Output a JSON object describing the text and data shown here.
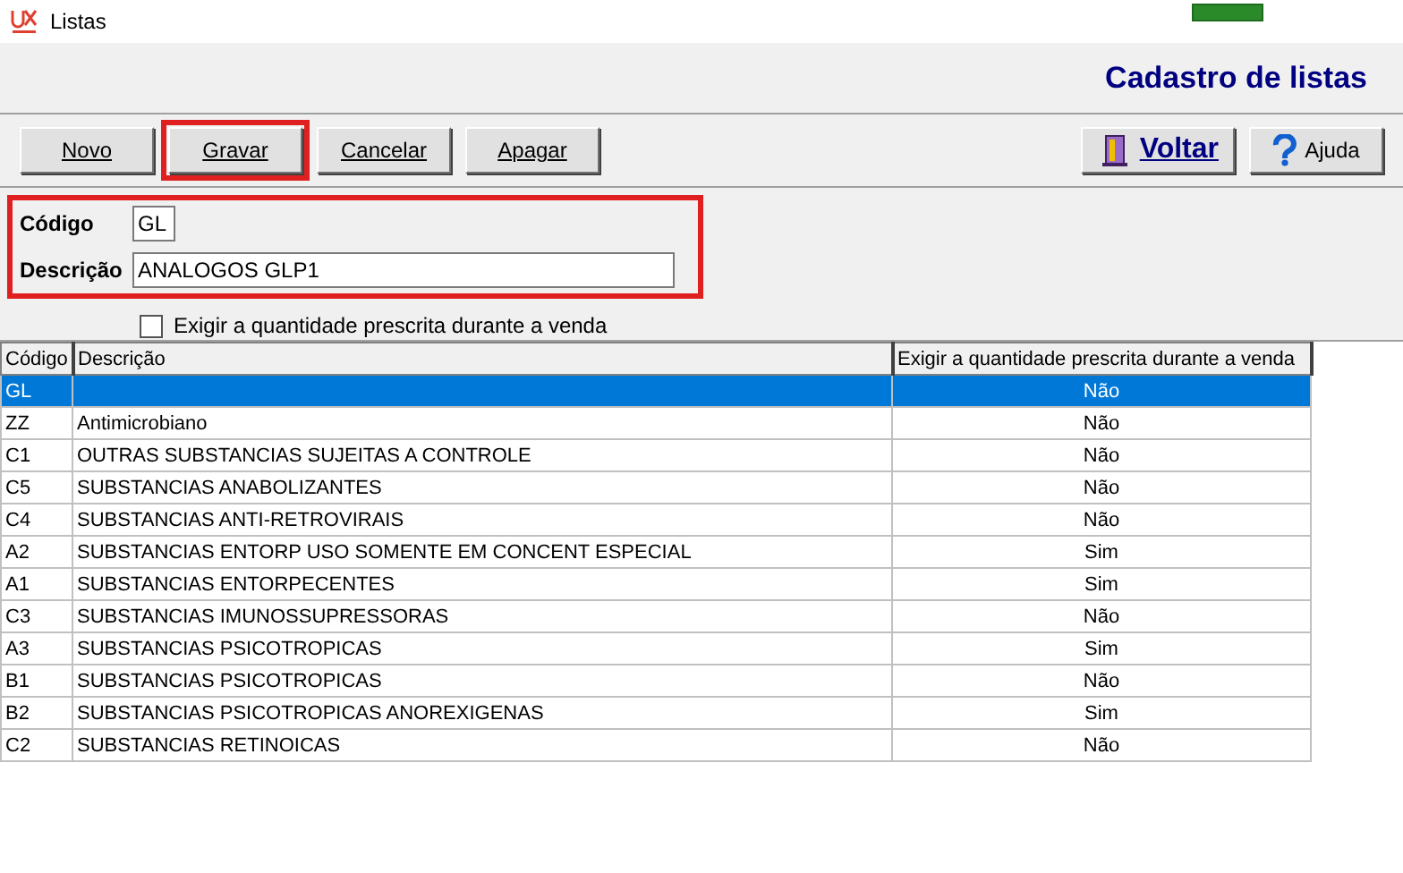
{
  "window": {
    "title": "Listas"
  },
  "header": {
    "title": "Cadastro de listas"
  },
  "toolbar": [
    {
      "label": "Novo",
      "kind": "text",
      "highlighted": false
    },
    {
      "label": "Gravar",
      "kind": "text",
      "highlighted": true
    },
    {
      "label": "Cancelar",
      "kind": "text",
      "highlighted": false
    },
    {
      "label": "Apagar",
      "kind": "text",
      "highlighted": false
    },
    {
      "label": "Voltar",
      "kind": "exit",
      "highlighted": false
    },
    {
      "label": "Ajuda",
      "kind": "help",
      "highlighted": false
    }
  ],
  "form": {
    "highlighted": true,
    "codigo": {
      "label": "Código",
      "value": "GL"
    },
    "descricao": {
      "label": "Descrição",
      "value": "ANALOGOS GLP1"
    },
    "checkbox": {
      "label": "Exigir a quantidade prescrita durante a venda",
      "checked": false
    }
  },
  "table": {
    "columns": [
      "Código",
      "Descrição",
      "Exigir a quantidade prescrita durante a venda"
    ],
    "rows": [
      {
        "cells": [
          "GL",
          "",
          "Não"
        ],
        "selected": true
      },
      {
        "cells": [
          "ZZ",
          "Antimicrobiano",
          "Não"
        ],
        "selected": false
      },
      {
        "cells": [
          "C1",
          "OUTRAS SUBSTANCIAS SUJEITAS A CONTROLE",
          "Não"
        ],
        "selected": false
      },
      {
        "cells": [
          "C5",
          "SUBSTANCIAS ANABOLIZANTES",
          "Não"
        ],
        "selected": false
      },
      {
        "cells": [
          "C4",
          "SUBSTANCIAS ANTI-RETROVIRAIS",
          "Não"
        ],
        "selected": false
      },
      {
        "cells": [
          "A2",
          "SUBSTANCIAS ENTORP USO SOMENTE EM CONCENT ESPECIAL",
          "Sim"
        ],
        "selected": false
      },
      {
        "cells": [
          "A1",
          "SUBSTANCIAS ENTORPECENTES",
          "Sim"
        ],
        "selected": false
      },
      {
        "cells": [
          "C3",
          "SUBSTANCIAS IMUNOSSUPRESSORAS",
          "Não"
        ],
        "selected": false
      },
      {
        "cells": [
          "A3",
          "SUBSTANCIAS PSICOTROPICAS",
          "Sim"
        ],
        "selected": false
      },
      {
        "cells": [
          "B1",
          "SUBSTANCIAS PSICOTROPICAS",
          "Não"
        ],
        "selected": false
      },
      {
        "cells": [
          "B2",
          "SUBSTANCIAS PSICOTROPICAS ANOREXIGENAS",
          "Sim"
        ],
        "selected": false
      },
      {
        "cells": [
          "C2",
          "SUBSTANCIAS RETINOICAS",
          "Não"
        ],
        "selected": false
      }
    ]
  }
}
